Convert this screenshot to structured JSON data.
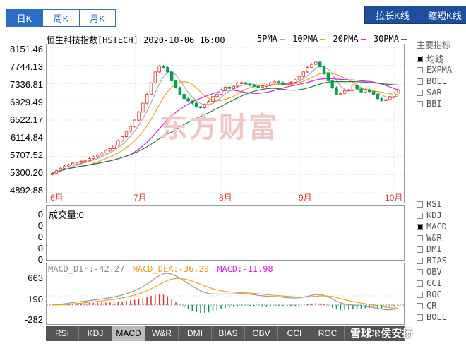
{
  "period_tabs": [
    {
      "label": "日K",
      "active": true
    },
    {
      "label": "周K",
      "active": false
    },
    {
      "label": "月K",
      "active": false
    }
  ],
  "toolbar": {
    "stretch_label": "拉长K线",
    "shrink_label": "缩短K线"
  },
  "chart_header": {
    "title": "恒生科技指数[HSTECH] 2020-10-06 16:00",
    "ma_legend": [
      {
        "label": "5PMA",
        "color": "#aaaaaa"
      },
      {
        "label": "10PMA",
        "color": "#f0a020"
      },
      {
        "label": "20PMA",
        "color": "#e020e0"
      },
      {
        "label": "30PMA",
        "color": "#208040"
      }
    ]
  },
  "price_axis": {
    "labels": [
      "8151.46",
      "7744.13",
      "7336.81",
      "6929.49",
      "6522.17",
      "6114.84",
      "5707.52",
      "5300.20",
      "4892.88"
    ]
  },
  "months": [
    "6月",
    "7月",
    "8月",
    "9月",
    "10月"
  ],
  "watermark": "东方财富",
  "volume": {
    "title": "成交量:",
    "value": "0",
    "axis": [
      "0",
      "0",
      "0",
      "0",
      "0"
    ]
  },
  "macd": {
    "dif_label": "MACD_DIF:",
    "dif_value": "-42.27",
    "dea_label": "MACD_DEA:",
    "dea_value": "-36.28",
    "macd_label": "MACD:",
    "macd_value": "-11.98",
    "axis": [
      "663",
      "190",
      "-282"
    ],
    "colors": {
      "dif": "#999999",
      "dea": "#f0a020",
      "macd": "#e020e0"
    }
  },
  "side_main": {
    "title": "主要指标",
    "items": [
      {
        "label": "均线",
        "checked": true
      },
      {
        "label": "EXPMA",
        "checked": false
      },
      {
        "label": "BOLL",
        "checked": false
      },
      {
        "label": "SAR",
        "checked": false
      },
      {
        "label": "BBI",
        "checked": false
      }
    ]
  },
  "side_sub": {
    "items": [
      {
        "label": "RSI",
        "checked": false
      },
      {
        "label": "KDJ",
        "checked": false
      },
      {
        "label": "MACD",
        "checked": true
      },
      {
        "label": "W&R",
        "checked": false
      },
      {
        "label": "DMI",
        "checked": false
      },
      {
        "label": "BIAS",
        "checked": false
      },
      {
        "label": "OBV",
        "checked": false
      },
      {
        "label": "CCI",
        "checked": false
      },
      {
        "label": "ROC",
        "checked": false
      },
      {
        "label": "CR",
        "checked": false
      },
      {
        "label": "BOLL",
        "checked": false
      }
    ]
  },
  "bottom_tabs": [
    {
      "label": "RSI",
      "active": false
    },
    {
      "label": "KDJ",
      "active": false
    },
    {
      "label": "MACD",
      "active": true
    },
    {
      "label": "W&R",
      "active": false
    },
    {
      "label": "DMI",
      "active": false
    },
    {
      "label": "BIAS",
      "active": false
    },
    {
      "label": "OBV",
      "active": false
    },
    {
      "label": "CCI",
      "active": false
    },
    {
      "label": "ROC",
      "active": false
    },
    {
      "label": "CR",
      "active": false
    }
  ],
  "footer_watermark": "雪球 : 侯安扬",
  "colors": {
    "up": "#e03030",
    "down": "#00a050",
    "tab_blue": "#2b6cc4",
    "dark_button": "#1e4f9e"
  },
  "chart_data": {
    "type": "candlestick",
    "x_labels": [
      "6月",
      "7月",
      "8月",
      "9月",
      "10月"
    ],
    "y_range": [
      4892.88,
      8151.46
    ],
    "closes": [
      5330,
      5390,
      5440,
      5490,
      5520,
      5560,
      5560,
      5600,
      5620,
      5660,
      5700,
      5740,
      5790,
      5840,
      5880,
      5960,
      6060,
      6150,
      6270,
      6380,
      6520,
      6700,
      6900,
      7100,
      7350,
      7600,
      7730,
      7700,
      7600,
      7400,
      7250,
      7100,
      7000,
      6950,
      6900,
      6820,
      6800,
      6870,
      6940,
      7050,
      7100,
      7200,
      7260,
      7230,
      7280,
      7350,
      7360,
      7330,
      7300,
      7280,
      7260,
      7280,
      7300,
      7350,
      7380,
      7360,
      7320,
      7340,
      7370,
      7420,
      7500,
      7600,
      7700,
      7770,
      7820,
      7720,
      7560,
      7400,
      7250,
      7100,
      7120,
      7180,
      7200,
      7300,
      7220,
      7150,
      7200,
      7160,
      7100,
      7000,
      6960,
      6980,
      7050,
      7130,
      7200
    ]
  }
}
